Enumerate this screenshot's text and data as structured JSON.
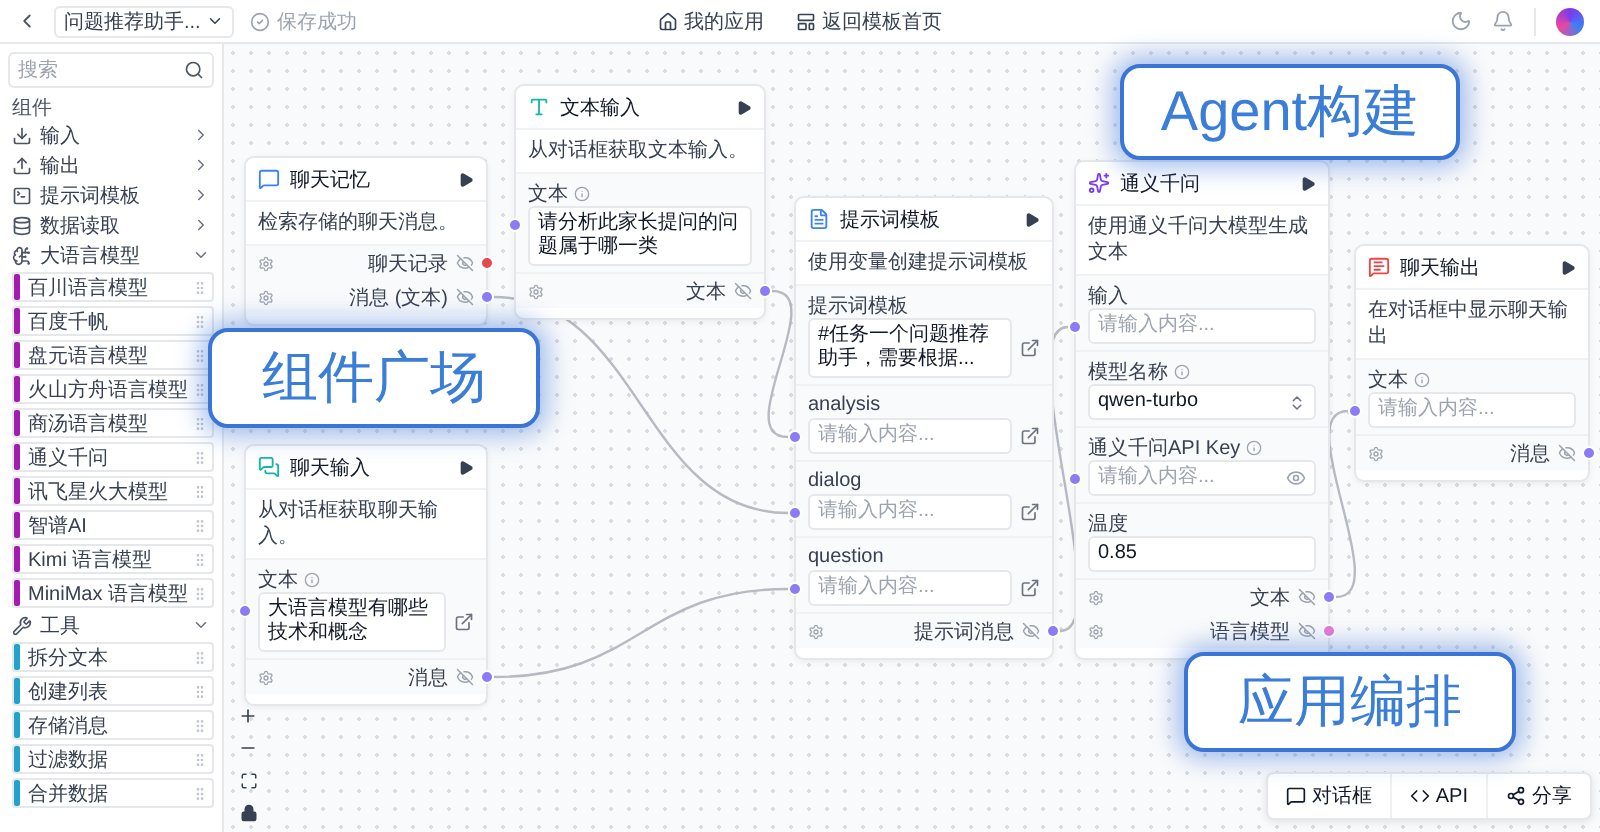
{
  "topbar": {
    "app_name": "问题推荐助手...",
    "save_status": "保存成功",
    "links": [
      "我的应用",
      "返回模板首页"
    ]
  },
  "sidebar": {
    "search": {
      "placeholder": "搜索"
    },
    "section_title": "组件",
    "groups": [
      {
        "label": "输入",
        "expanded": false
      },
      {
        "label": "输出",
        "expanded": false
      },
      {
        "label": "提示词模板",
        "expanded": false
      },
      {
        "label": "数据读取",
        "expanded": false
      },
      {
        "label": "大语言模型",
        "expanded": true,
        "children": [
          {
            "label": "百川语言模型",
            "color": "#a21caf"
          },
          {
            "label": "百度千帆",
            "color": "#a21caf"
          },
          {
            "label": "盘元语言模型",
            "color": "#a21caf"
          },
          {
            "label": "火山方舟语言模型",
            "color": "#a21caf"
          },
          {
            "label": "商汤语言模型",
            "color": "#a21caf"
          },
          {
            "label": "通义千问",
            "color": "#a21caf"
          },
          {
            "label": "讯飞星火大模型",
            "color": "#a21caf"
          },
          {
            "label": "智谱AI",
            "color": "#a21caf"
          },
          {
            "label": "Kimi 语言模型",
            "color": "#a21caf"
          },
          {
            "label": "MiniMax 语言模型",
            "color": "#a21caf"
          }
        ]
      },
      {
        "label": "工具",
        "expanded": true,
        "children": [
          {
            "label": "拆分文本",
            "color": "#22a3c9"
          },
          {
            "label": "创建列表",
            "color": "#22a3c9"
          },
          {
            "label": "存储消息",
            "color": "#22a3c9"
          },
          {
            "label": "过滤数据",
            "color": "#22a3c9"
          },
          {
            "label": "合并数据",
            "color": "#22a3c9"
          }
        ]
      }
    ]
  },
  "nodes": [
    {
      "title": "聊天记忆",
      "description": "检索存储的聊天消息。",
      "outputs": [
        {
          "label": "聊天记录",
          "color": "#e5484d"
        },
        {
          "label": "消息 (文本)",
          "color": "#8b7cf6"
        }
      ]
    },
    {
      "title": "文本输入",
      "description": "从对话框获取文本输入。",
      "fields": [
        {
          "label": "文本",
          "info": true,
          "kind": "text",
          "value": "请分析此家长提问的问题属于哪一类",
          "input_handle": true
        }
      ],
      "outputs": [
        {
          "label": "文本",
          "color": "#8b7cf6"
        }
      ]
    },
    {
      "title": "聊天输入",
      "description": "从对话框获取聊天输入。",
      "fields": [
        {
          "label": "文本",
          "info": true,
          "kind": "expand",
          "value": "大语言模型有哪些技术和概念",
          "input_handle": true
        }
      ],
      "outputs": [
        {
          "label": "消息",
          "color": "#8b7cf6"
        }
      ]
    },
    {
      "title": "提示词模板",
      "description": "使用变量创建提示词模板",
      "fields": [
        {
          "label": "提示词模板",
          "info": false,
          "kind": "expand",
          "value": "#任务一个问题推荐助手，需要根据...",
          "input_handle": false
        },
        {
          "label": "analysis",
          "info": false,
          "kind": "expand",
          "placeholder": "请输入内容...",
          "input_handle": true
        },
        {
          "label": "dialog",
          "info": false,
          "kind": "expand",
          "placeholder": "请输入内容...",
          "input_handle": true
        },
        {
          "label": "question",
          "info": false,
          "kind": "expand",
          "placeholder": "请输入内容...",
          "input_handle": true
        }
      ],
      "outputs": [
        {
          "label": "提示词消息",
          "color": "#8b7cf6"
        }
      ]
    },
    {
      "title": "通义千问",
      "description": "使用通义千问大模型生成文本",
      "fields": [
        {
          "label": "输入",
          "info": false,
          "kind": "text",
          "placeholder": "请输入内容...",
          "input_handle": true
        },
        {
          "label": "模型名称",
          "info": true,
          "kind": "select",
          "value": "qwen-turbo",
          "input_handle": false
        },
        {
          "label": "通义千问API Key",
          "info": true,
          "kind": "password",
          "placeholder": "请输入内容...",
          "input_handle": true
        },
        {
          "label": "温度",
          "info": false,
          "kind": "text",
          "value": "0.85",
          "input_handle": false
        }
      ],
      "outputs": [
        {
          "label": "文本",
          "color": "#8b7cf6"
        },
        {
          "label": "语言模型",
          "color": "#e879d8"
        }
      ]
    },
    {
      "title": "聊天输出",
      "description": "在对话框中显示聊天输出",
      "fields": [
        {
          "label": "文本",
          "info": true,
          "kind": "text",
          "placeholder": "请输入内容...",
          "input_handle": true
        }
      ],
      "outputs": [
        {
          "label": "消息",
          "color": "#8b7cf6"
        }
      ]
    }
  ],
  "callouts": [
    "Agent构建",
    "组件广场",
    "应用编排"
  ],
  "canvas_toolbar": [
    {
      "label": "对话框"
    },
    {
      "label": "API"
    },
    {
      "label": "分享"
    }
  ]
}
